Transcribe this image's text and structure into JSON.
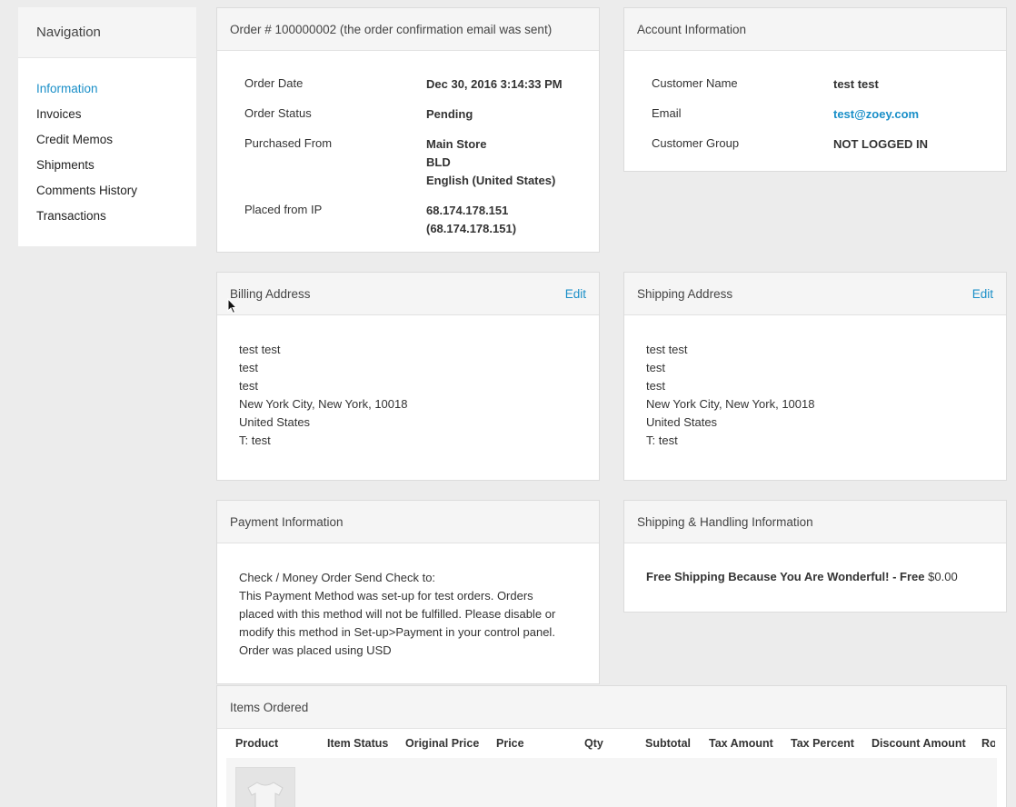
{
  "nav": {
    "title": "Navigation",
    "items": [
      "Information",
      "Invoices",
      "Credit Memos",
      "Shipments",
      "Comments History",
      "Transactions"
    ]
  },
  "order": {
    "title": "Order # 100000002 (the order confirmation email was sent)",
    "date_label": "Order Date",
    "date": "Dec 30, 2016 3:14:33 PM",
    "status_label": "Order Status",
    "status": "Pending",
    "purchased_label": "Purchased From",
    "purchased": [
      "Main Store",
      "BLD",
      "English (United States)"
    ],
    "ip_label": "Placed from IP",
    "ip": [
      "68.174.178.151",
      "(68.174.178.151)"
    ]
  },
  "account": {
    "title": "Account Information",
    "name_label": "Customer Name",
    "name": "test test",
    "email_label": "Email",
    "email": "test@zoey.com",
    "group_label": "Customer Group",
    "group": "NOT LOGGED IN"
  },
  "billing": {
    "title": "Billing Address",
    "edit": "Edit",
    "lines": [
      "test test",
      "test",
      "test",
      "New York City, New York, 10018",
      "United States",
      "T: test"
    ]
  },
  "shipping_address": {
    "title": "Shipping Address",
    "edit": "Edit",
    "lines": [
      "test test",
      "test",
      "test",
      "New York City, New York, 10018",
      "United States",
      "T: test"
    ]
  },
  "payment": {
    "title": "Payment Information",
    "lines": [
      "Check / Money Order Send Check to:",
      "This Payment Method was set-up for test orders. Orders",
      "placed with this method will not be fulfilled. Please disable or",
      "modify this method in Set-up>Payment in your control panel.",
      "Order was placed using USD"
    ]
  },
  "shipping_handling": {
    "title": "Shipping & Handling Information",
    "method": "Free Shipping Because You Are Wonderful! - Free",
    "price": "$0.00"
  },
  "items": {
    "title": "Items Ordered",
    "columns": [
      "Product",
      "Item Status",
      "Original Price",
      "Price",
      "Qty",
      "Subtotal",
      "Tax Amount",
      "Tax Percent",
      "Discount Amount",
      "Ro"
    ]
  }
}
